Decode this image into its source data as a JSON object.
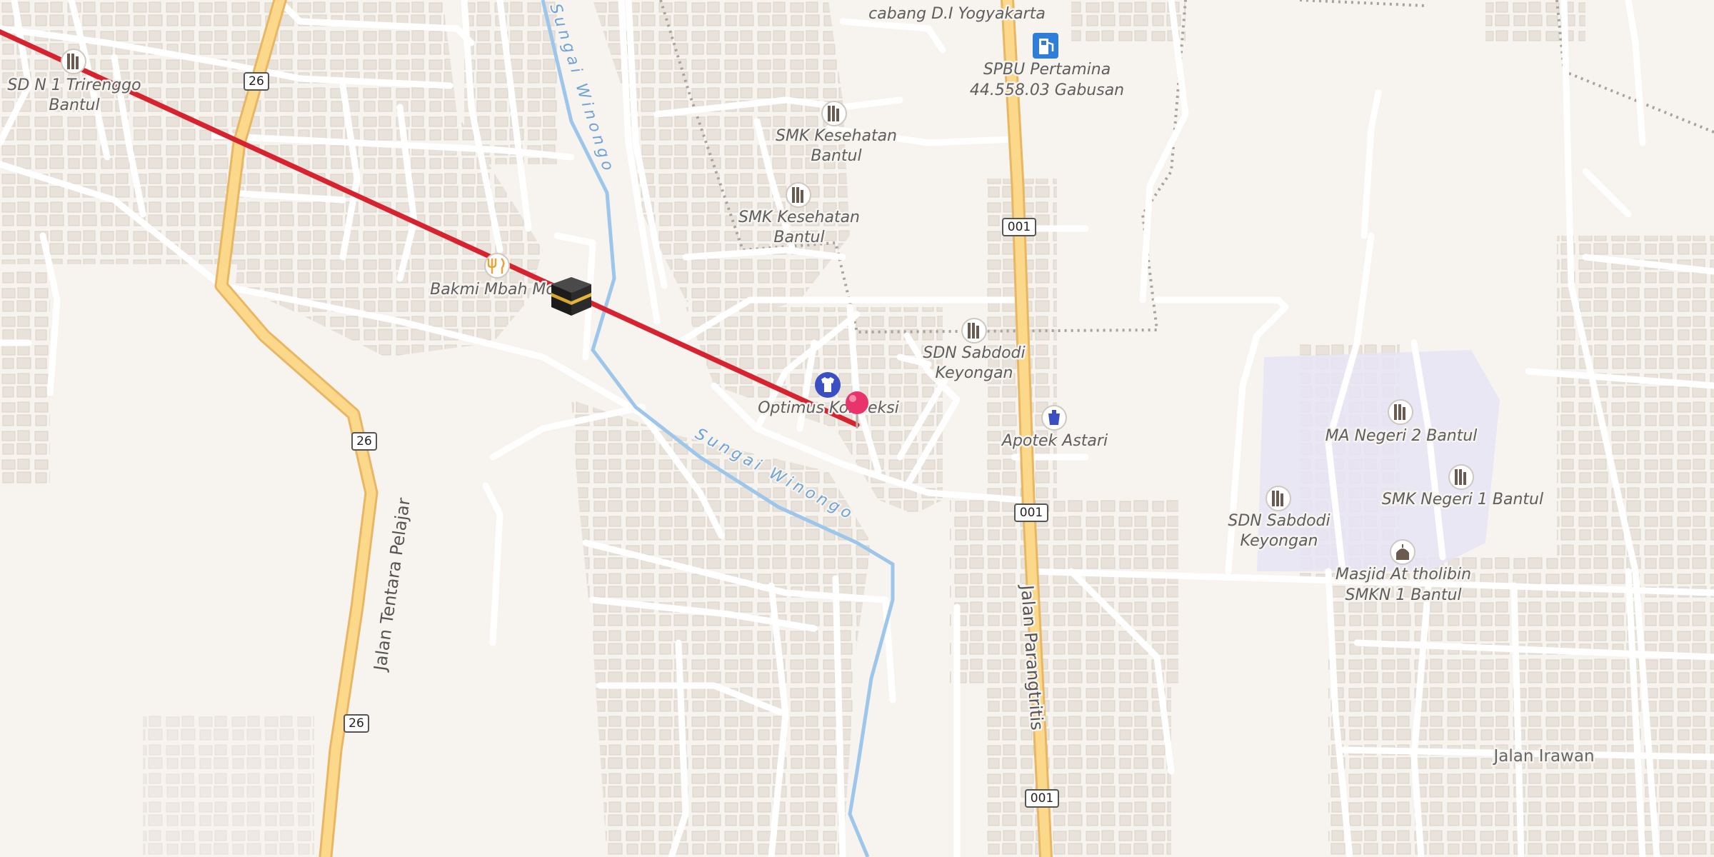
{
  "map": {
    "place_labels": {
      "sdn1_trirenggo": [
        "SD N 1 Trirenggo",
        "Bantul"
      ],
      "cabang_diy": [
        "cabang D.I Yogyakarta"
      ],
      "spbu": [
        "SPBU Pertamina",
        "44.558.03 Gabusan"
      ],
      "smk_kes_1": [
        "SMK Kesehatan",
        "Bantul"
      ],
      "smk_kes_2": [
        "SMK Kesehatan",
        "Bantul"
      ],
      "bakmi": [
        "Bakmi Mbah Mo"
      ],
      "sdn_sabdodi_1": [
        "SDN Sabdodi",
        "Keyongan"
      ],
      "optimus": [
        "Optimus Konveksi"
      ],
      "apotek": [
        "Apotek Astari"
      ],
      "ma_negeri": [
        "MA Negeri 2 Bantul"
      ],
      "smk_negeri": [
        "SMK Negeri 1 Bantul"
      ],
      "sdn_sabdodi_2": [
        "SDN Sabdodi",
        "Keyongan"
      ],
      "masjid": [
        "Masjid At tholibin",
        "SMKN 1 Bantul"
      ]
    },
    "street_names": {
      "tentara_pelajar": "Jalan Tentara Pelajar",
      "parangtritis": "Jalan Parangtritis",
      "irawan": "Jalan Irawan",
      "river_north": "Sungai Winongo",
      "river_south": "Sungai Winongo"
    },
    "route_shields": {
      "r26_a": "26",
      "r26_b": "26",
      "r26_c": "26",
      "r001_a": "001",
      "r001_b": "001",
      "r001_c": "001"
    },
    "colors": {
      "background": "#f7f4f0",
      "building": "#e8e2da",
      "minor_road": "#ffffff",
      "major_road": "#fcd88a",
      "major_road_casing": "#e9b764",
      "river": "#9cc6ea",
      "route_line": "#d7232f",
      "pin": "#e8336c",
      "school_area": "#e8e4f4"
    },
    "icons": {
      "school": "school-icon",
      "restaurant": "restaurant-icon",
      "fuel": "fuel-station-icon",
      "clothing": "clothing-store-icon",
      "pharmacy": "pharmacy-icon",
      "mosque": "mosque-icon",
      "kaaba": "kaaba-icon",
      "pin": "location-pin-icon"
    }
  }
}
